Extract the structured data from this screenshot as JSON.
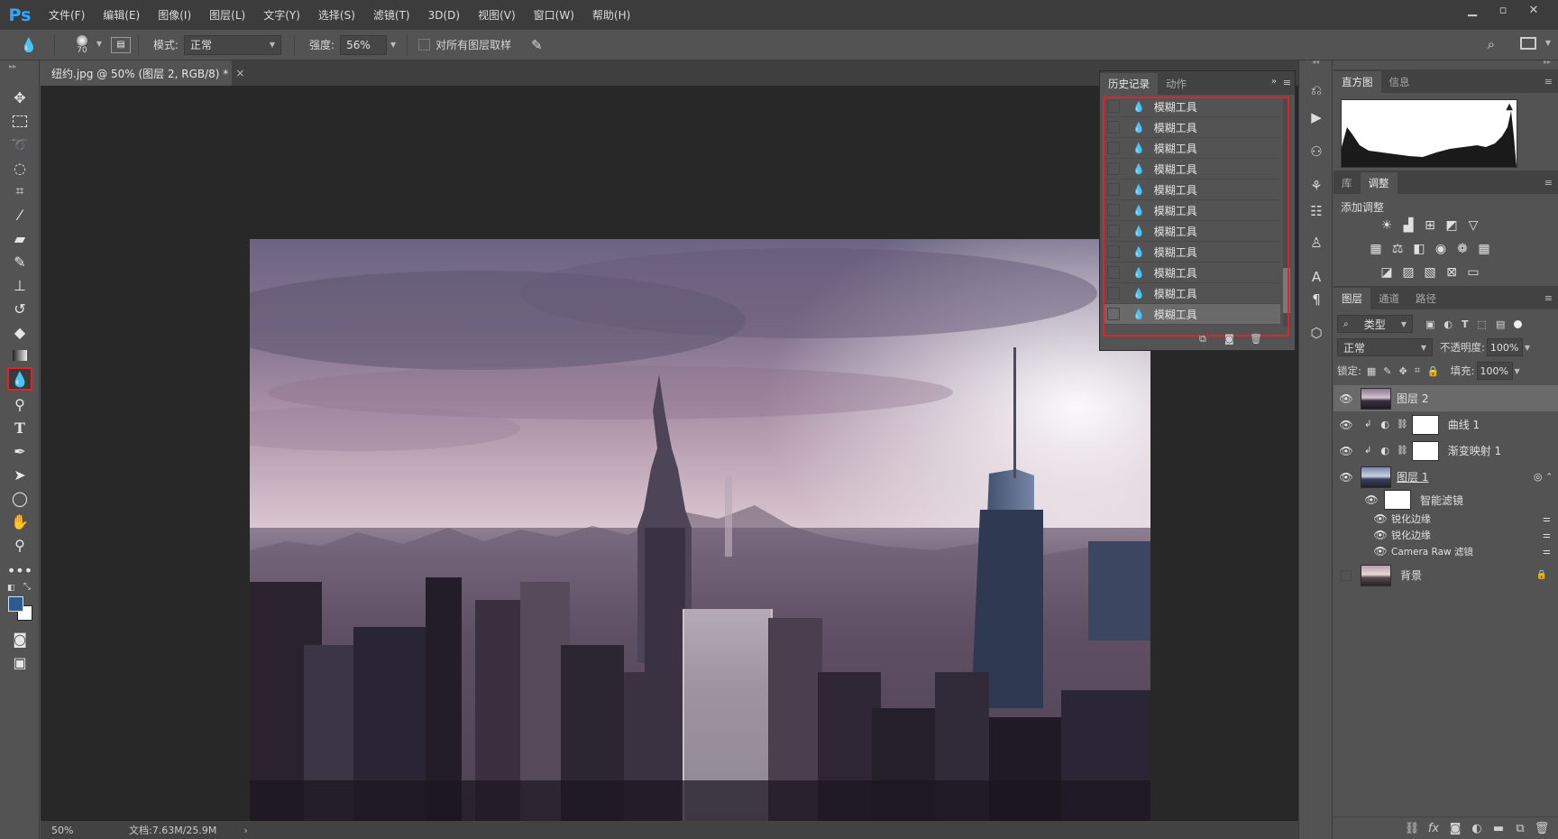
{
  "app": {
    "logo": "Ps"
  },
  "menubar": {
    "items": [
      "文件(F)",
      "编辑(E)",
      "图像(I)",
      "图层(L)",
      "文字(Y)",
      "选择(S)",
      "滤镜(T)",
      "3D(D)",
      "视图(V)",
      "窗口(W)",
      "帮助(H)"
    ],
    "window_controls": [
      "minimize",
      "restore",
      "close"
    ]
  },
  "options_bar": {
    "brush_size": "70",
    "mode_label": "模式:",
    "mode_value": "正常",
    "strength_label": "强度:",
    "strength_value": "56%",
    "sample_all_label": "对所有图层取样",
    "sample_all_checked": false
  },
  "document": {
    "tab_title": "纽约.jpg @ 50% (图层 2, RGB/8) *",
    "close_glyph": "×",
    "zoom": "50%",
    "doc_info": "文档:7.63M/25.9M"
  },
  "toolbar": {
    "active_tool": "blur-tool",
    "tools": [
      "move",
      "marquee",
      "lasso",
      "quick-select",
      "crop",
      "eyedropper",
      "healing",
      "brush",
      "stamp",
      "history-brush",
      "eraser",
      "gradient",
      "blur",
      "dodge",
      "type",
      "pen",
      "path-select",
      "shape",
      "hand",
      "zoom",
      "more"
    ]
  },
  "history_panel": {
    "tabs": [
      "历史记录",
      "动作"
    ],
    "active_tab": "历史记录",
    "items": [
      "模糊工具",
      "模糊工具",
      "模糊工具",
      "模糊工具",
      "模糊工具",
      "模糊工具",
      "模糊工具",
      "模糊工具",
      "模糊工具",
      "模糊工具",
      "模糊工具"
    ],
    "selected_index": 10,
    "highlight_color": "#e0232b"
  },
  "histogram_panel": {
    "tabs": [
      "直方图",
      "信息"
    ],
    "active_tab": "直方图"
  },
  "adjustments_panel": {
    "tabs": [
      "库",
      "调整"
    ],
    "active_tab": "调整",
    "add_label": "添加调整"
  },
  "layers_panel": {
    "tabs": [
      "图层",
      "通道",
      "路径"
    ],
    "active_tab": "图层",
    "filter_kind": "类型",
    "blend_mode": "正常",
    "opacity_label": "不透明度:",
    "opacity_value": "100%",
    "lock_label": "锁定:",
    "fill_label": "填充:",
    "fill_value": "100%",
    "layers": [
      {
        "name": "图层 2",
        "type": "pixel",
        "visible": true,
        "selected": true
      },
      {
        "name": "曲线 1",
        "type": "adjustment",
        "visible": true,
        "clipped": true
      },
      {
        "name": "渐变映射 1",
        "type": "adjustment",
        "visible": true,
        "clipped": true
      },
      {
        "name": "图层 1",
        "type": "smart-object",
        "visible": true
      },
      {
        "name": "智能滤镜",
        "type": "smart-filter-mask",
        "visible": true
      },
      {
        "name": "锐化边缘",
        "type": "filter",
        "visible": true
      },
      {
        "name": "锐化边缘",
        "type": "filter",
        "visible": true
      },
      {
        "name": "Camera Raw 滤镜",
        "type": "filter",
        "visible": true
      },
      {
        "name": "背景",
        "type": "background",
        "visible": false,
        "locked": true
      }
    ]
  },
  "colors": {
    "foreground": "#2d5b8e",
    "background": "#ffffff",
    "accent": "#31a8ff"
  }
}
